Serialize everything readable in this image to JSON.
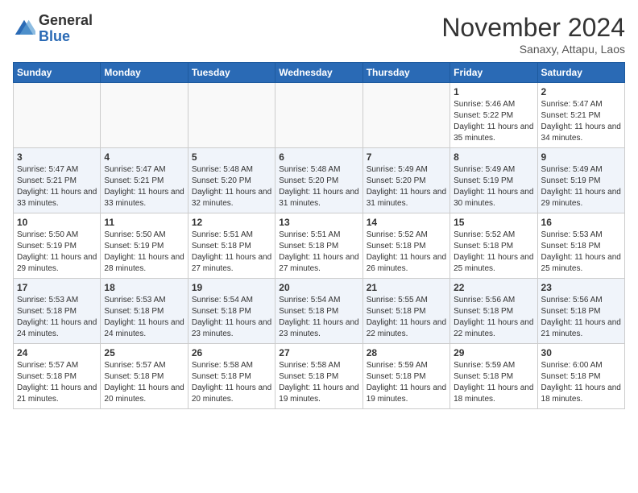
{
  "header": {
    "logo_general": "General",
    "logo_blue": "Blue",
    "month_title": "November 2024",
    "subtitle": "Sanaxy, Attapu, Laos"
  },
  "days_of_week": [
    "Sunday",
    "Monday",
    "Tuesday",
    "Wednesday",
    "Thursday",
    "Friday",
    "Saturday"
  ],
  "weeks": [
    [
      {
        "day": "",
        "info": ""
      },
      {
        "day": "",
        "info": ""
      },
      {
        "day": "",
        "info": ""
      },
      {
        "day": "",
        "info": ""
      },
      {
        "day": "",
        "info": ""
      },
      {
        "day": "1",
        "info": "Sunrise: 5:46 AM\nSunset: 5:22 PM\nDaylight: 11 hours\nand 35 minutes."
      },
      {
        "day": "2",
        "info": "Sunrise: 5:47 AM\nSunset: 5:21 PM\nDaylight: 11 hours\nand 34 minutes."
      }
    ],
    [
      {
        "day": "3",
        "info": "Sunrise: 5:47 AM\nSunset: 5:21 PM\nDaylight: 11 hours\nand 33 minutes."
      },
      {
        "day": "4",
        "info": "Sunrise: 5:47 AM\nSunset: 5:21 PM\nDaylight: 11 hours\nand 33 minutes."
      },
      {
        "day": "5",
        "info": "Sunrise: 5:48 AM\nSunset: 5:20 PM\nDaylight: 11 hours\nand 32 minutes."
      },
      {
        "day": "6",
        "info": "Sunrise: 5:48 AM\nSunset: 5:20 PM\nDaylight: 11 hours\nand 31 minutes."
      },
      {
        "day": "7",
        "info": "Sunrise: 5:49 AM\nSunset: 5:20 PM\nDaylight: 11 hours\nand 31 minutes."
      },
      {
        "day": "8",
        "info": "Sunrise: 5:49 AM\nSunset: 5:19 PM\nDaylight: 11 hours\nand 30 minutes."
      },
      {
        "day": "9",
        "info": "Sunrise: 5:49 AM\nSunset: 5:19 PM\nDaylight: 11 hours\nand 29 minutes."
      }
    ],
    [
      {
        "day": "10",
        "info": "Sunrise: 5:50 AM\nSunset: 5:19 PM\nDaylight: 11 hours\nand 29 minutes."
      },
      {
        "day": "11",
        "info": "Sunrise: 5:50 AM\nSunset: 5:19 PM\nDaylight: 11 hours\nand 28 minutes."
      },
      {
        "day": "12",
        "info": "Sunrise: 5:51 AM\nSunset: 5:18 PM\nDaylight: 11 hours\nand 27 minutes."
      },
      {
        "day": "13",
        "info": "Sunrise: 5:51 AM\nSunset: 5:18 PM\nDaylight: 11 hours\nand 27 minutes."
      },
      {
        "day": "14",
        "info": "Sunrise: 5:52 AM\nSunset: 5:18 PM\nDaylight: 11 hours\nand 26 minutes."
      },
      {
        "day": "15",
        "info": "Sunrise: 5:52 AM\nSunset: 5:18 PM\nDaylight: 11 hours\nand 25 minutes."
      },
      {
        "day": "16",
        "info": "Sunrise: 5:53 AM\nSunset: 5:18 PM\nDaylight: 11 hours\nand 25 minutes."
      }
    ],
    [
      {
        "day": "17",
        "info": "Sunrise: 5:53 AM\nSunset: 5:18 PM\nDaylight: 11 hours\nand 24 minutes."
      },
      {
        "day": "18",
        "info": "Sunrise: 5:53 AM\nSunset: 5:18 PM\nDaylight: 11 hours\nand 24 minutes."
      },
      {
        "day": "19",
        "info": "Sunrise: 5:54 AM\nSunset: 5:18 PM\nDaylight: 11 hours\nand 23 minutes."
      },
      {
        "day": "20",
        "info": "Sunrise: 5:54 AM\nSunset: 5:18 PM\nDaylight: 11 hours\nand 23 minutes."
      },
      {
        "day": "21",
        "info": "Sunrise: 5:55 AM\nSunset: 5:18 PM\nDaylight: 11 hours\nand 22 minutes."
      },
      {
        "day": "22",
        "info": "Sunrise: 5:56 AM\nSunset: 5:18 PM\nDaylight: 11 hours\nand 22 minutes."
      },
      {
        "day": "23",
        "info": "Sunrise: 5:56 AM\nSunset: 5:18 PM\nDaylight: 11 hours\nand 21 minutes."
      }
    ],
    [
      {
        "day": "24",
        "info": "Sunrise: 5:57 AM\nSunset: 5:18 PM\nDaylight: 11 hours\nand 21 minutes."
      },
      {
        "day": "25",
        "info": "Sunrise: 5:57 AM\nSunset: 5:18 PM\nDaylight: 11 hours\nand 20 minutes."
      },
      {
        "day": "26",
        "info": "Sunrise: 5:58 AM\nSunset: 5:18 PM\nDaylight: 11 hours\nand 20 minutes."
      },
      {
        "day": "27",
        "info": "Sunrise: 5:58 AM\nSunset: 5:18 PM\nDaylight: 11 hours\nand 19 minutes."
      },
      {
        "day": "28",
        "info": "Sunrise: 5:59 AM\nSunset: 5:18 PM\nDaylight: 11 hours\nand 19 minutes."
      },
      {
        "day": "29",
        "info": "Sunrise: 5:59 AM\nSunset: 5:18 PM\nDaylight: 11 hours\nand 18 minutes."
      },
      {
        "day": "30",
        "info": "Sunrise: 6:00 AM\nSunset: 5:18 PM\nDaylight: 11 hours\nand 18 minutes."
      }
    ]
  ]
}
